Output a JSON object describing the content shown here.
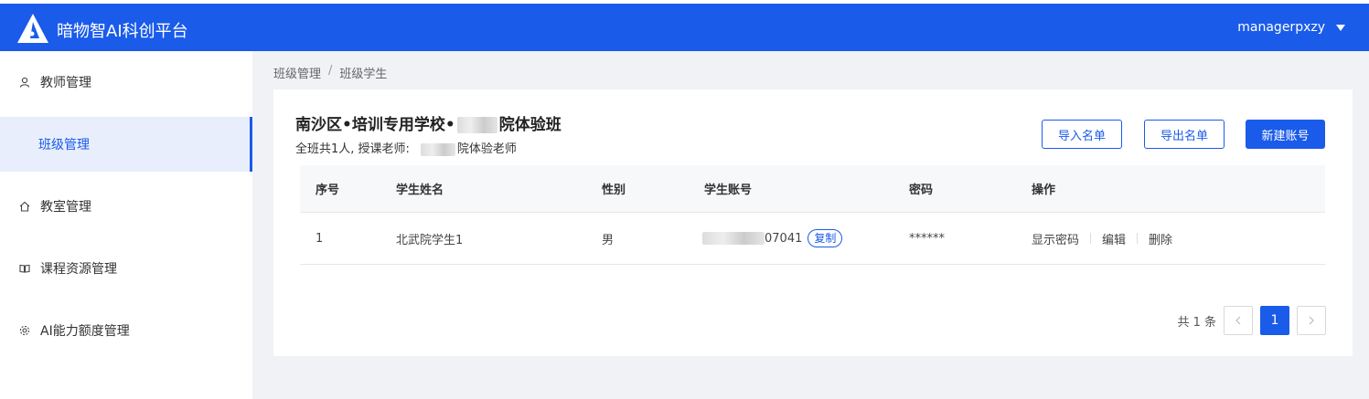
{
  "header": {
    "app_title": "暗物智AI科创平台",
    "username": "managerpxzy",
    "brand_color": "#1a5bea"
  },
  "sidebar": {
    "items": [
      {
        "label": "教师管理",
        "icon": "user-icon"
      },
      {
        "label": "班级管理",
        "icon": "",
        "active": true
      },
      {
        "label": "教室管理",
        "icon": "home-icon"
      },
      {
        "label": "课程资源管理",
        "icon": "book-icon"
      },
      {
        "label": "AI能力额度管理",
        "icon": "gear-icon"
      }
    ]
  },
  "breadcrumb": {
    "items": [
      "班级管理",
      "班级学生"
    ],
    "separator": "/"
  },
  "class_info": {
    "title_prefix": "南沙区•培训专用学校•",
    "title_suffix": "院体验班",
    "sub_prefix": "全班共1人, 授课老师:",
    "sub_suffix": "院体验老师"
  },
  "actions": {
    "import_label": "导入名单",
    "export_label": "导出名单",
    "new_label": "新建账号"
  },
  "table": {
    "headers": [
      "序号",
      "学生姓名",
      "性别",
      "学生账号",
      "密码",
      "操作"
    ],
    "rows": [
      {
        "index": "1",
        "name": "北武院学生1",
        "gender": "男",
        "account_suffix": "07041",
        "copy_label": "复制",
        "password": "******",
        "ops": [
          "显示密码",
          "编辑",
          "删除"
        ]
      }
    ]
  },
  "pagination": {
    "total_text": "共 1 条",
    "current_page": "1",
    "prev_icon": "chevron-left-icon",
    "next_icon": "chevron-right-icon"
  }
}
